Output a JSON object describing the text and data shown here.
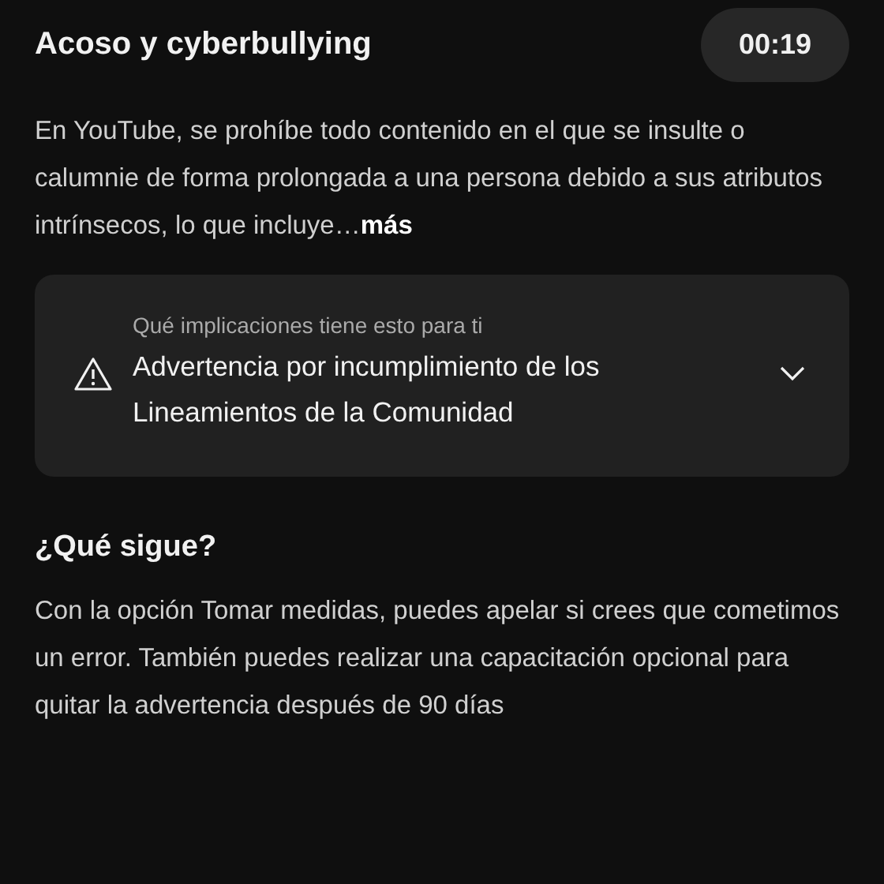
{
  "header": {
    "title": "Acoso y cyberbullying",
    "timestamp": "00:19"
  },
  "description": {
    "text": "En YouTube, se prohíbe todo contenido en el que se insulte o calumnie de forma prolongada a una persona debido a sus atributos intrínsecos, lo que incluye…",
    "more_link": "más"
  },
  "implications_card": {
    "caption": "Qué implicaciones tiene esto para ti",
    "title": "Advertencia por incumplimiento de los Lineamientos de la Comunidad",
    "expanded": false
  },
  "next_steps": {
    "heading": "¿Qué sigue?",
    "text": "Con la opción Tomar medidas, puedes apelar si crees que cometimos un error. También puedes realizar una capacitación opcional para quitar la advertencia después de 90 días"
  }
}
